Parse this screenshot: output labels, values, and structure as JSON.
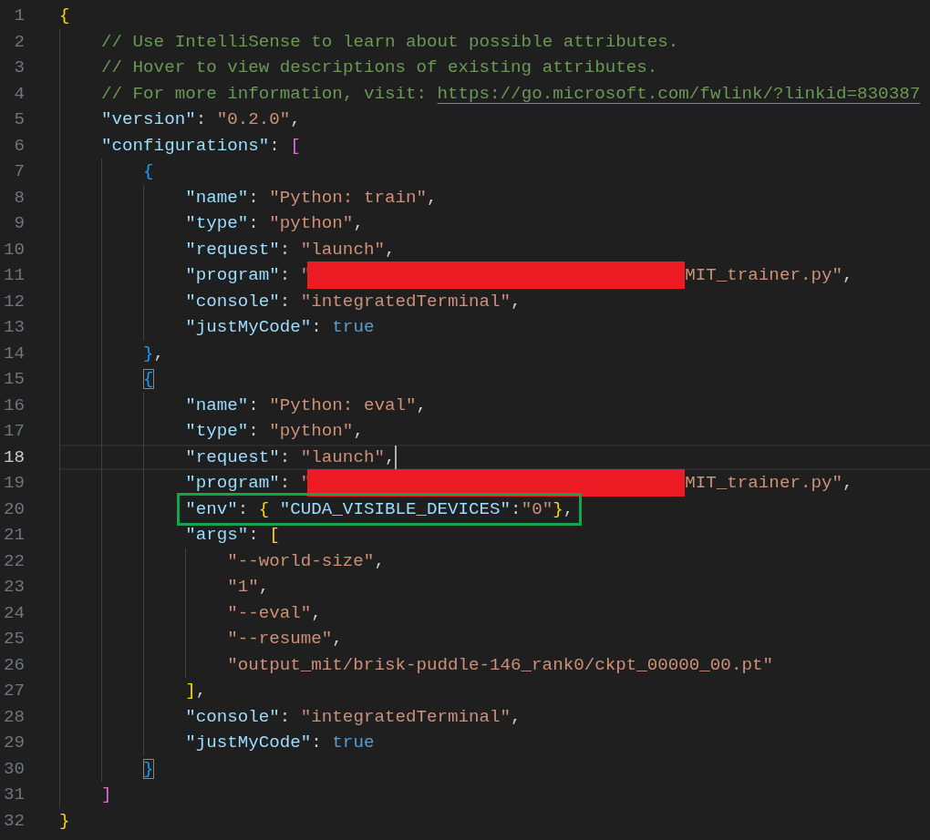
{
  "editor": {
    "lines": [
      {
        "number": "1",
        "current": false,
        "boxed": false,
        "tokens": [
          {
            "kind": "bracket",
            "text": "{",
            "color": "#ffd700",
            "matched": false
          }
        ]
      },
      {
        "number": "2",
        "current": false,
        "boxed": false,
        "tokens": [
          {
            "kind": "comment",
            "text": "    // Use IntelliSense to learn about possible attributes."
          }
        ]
      },
      {
        "number": "3",
        "current": false,
        "boxed": false,
        "tokens": [
          {
            "kind": "comment",
            "text": "    // Hover to view descriptions of existing attributes."
          }
        ]
      },
      {
        "number": "4",
        "current": false,
        "boxed": false,
        "tokens": [
          {
            "kind": "comment",
            "text": "    // For more information, visit: "
          },
          {
            "kind": "link",
            "text": "https://go.microsoft.com/fwlink/?linkid=830387"
          }
        ]
      },
      {
        "number": "5",
        "current": false,
        "boxed": false,
        "tokens": [
          {
            "kind": "key",
            "text": "    \"version\""
          },
          {
            "kind": "punct",
            "text": ": "
          },
          {
            "kind": "string",
            "text": "\"0.2.0\""
          },
          {
            "kind": "punct",
            "text": ","
          }
        ]
      },
      {
        "number": "6",
        "current": false,
        "boxed": false,
        "tokens": [
          {
            "kind": "key",
            "text": "    \"configurations\""
          },
          {
            "kind": "punct",
            "text": ": "
          },
          {
            "kind": "bracket",
            "text": "[",
            "color": "#da70d6",
            "matched": false
          }
        ]
      },
      {
        "number": "7",
        "current": false,
        "boxed": false,
        "tokens": [
          {
            "kind": "bracket",
            "text": "        {",
            "color": "#179fff",
            "matched": false
          }
        ]
      },
      {
        "number": "8",
        "current": false,
        "boxed": false,
        "tokens": [
          {
            "kind": "key",
            "text": "            \"name\""
          },
          {
            "kind": "punct",
            "text": ": "
          },
          {
            "kind": "string",
            "text": "\"Python: train\""
          },
          {
            "kind": "punct",
            "text": ","
          }
        ]
      },
      {
        "number": "9",
        "current": false,
        "boxed": false,
        "tokens": [
          {
            "kind": "key",
            "text": "            \"type\""
          },
          {
            "kind": "punct",
            "text": ": "
          },
          {
            "kind": "string",
            "text": "\"python\""
          },
          {
            "kind": "punct",
            "text": ","
          }
        ]
      },
      {
        "number": "10",
        "current": false,
        "boxed": false,
        "tokens": [
          {
            "kind": "key",
            "text": "            \"request\""
          },
          {
            "kind": "punct",
            "text": ": "
          },
          {
            "kind": "string",
            "text": "\"launch\""
          },
          {
            "kind": "punct",
            "text": ","
          }
        ]
      },
      {
        "number": "11",
        "current": false,
        "boxed": false,
        "tokens": [
          {
            "kind": "key",
            "text": "            \"program\""
          },
          {
            "kind": "punct",
            "text": ": "
          },
          {
            "kind": "string",
            "text": "\""
          },
          {
            "kind": "redaction"
          },
          {
            "kind": "string",
            "text": "MIT_trainer.py\""
          },
          {
            "kind": "punct",
            "text": ","
          }
        ]
      },
      {
        "number": "12",
        "current": false,
        "boxed": false,
        "tokens": [
          {
            "kind": "key",
            "text": "            \"console\""
          },
          {
            "kind": "punct",
            "text": ": "
          },
          {
            "kind": "string",
            "text": "\"integratedTerminal\""
          },
          {
            "kind": "punct",
            "text": ","
          }
        ]
      },
      {
        "number": "13",
        "current": false,
        "boxed": false,
        "tokens": [
          {
            "kind": "key",
            "text": "            \"justMyCode\""
          },
          {
            "kind": "punct",
            "text": ": "
          },
          {
            "kind": "keyword",
            "text": "true"
          }
        ]
      },
      {
        "number": "14",
        "current": false,
        "boxed": false,
        "tokens": [
          {
            "kind": "bracket",
            "text": "        }",
            "color": "#179fff",
            "matched": false
          },
          {
            "kind": "punct",
            "text": ","
          }
        ]
      },
      {
        "number": "15",
        "current": false,
        "boxed": false,
        "tokens": [
          {
            "kind": "bracket",
            "text": "        {",
            "color": "#179fff",
            "matched": true
          }
        ]
      },
      {
        "number": "16",
        "current": false,
        "boxed": false,
        "tokens": [
          {
            "kind": "key",
            "text": "            \"name\""
          },
          {
            "kind": "punct",
            "text": ": "
          },
          {
            "kind": "string",
            "text": "\"Python: eval\""
          },
          {
            "kind": "punct",
            "text": ","
          }
        ]
      },
      {
        "number": "17",
        "current": false,
        "boxed": false,
        "tokens": [
          {
            "kind": "key",
            "text": "            \"type\""
          },
          {
            "kind": "punct",
            "text": ": "
          },
          {
            "kind": "string",
            "text": "\"python\""
          },
          {
            "kind": "punct",
            "text": ","
          }
        ]
      },
      {
        "number": "18",
        "current": true,
        "boxed": false,
        "tokens": [
          {
            "kind": "key",
            "text": "            \"request\""
          },
          {
            "kind": "punct",
            "text": ": "
          },
          {
            "kind": "string",
            "text": "\"launch\""
          },
          {
            "kind": "punct",
            "text": ","
          }
        ]
      },
      {
        "number": "19",
        "current": false,
        "boxed": false,
        "tokens": [
          {
            "kind": "key",
            "text": "            \"program\""
          },
          {
            "kind": "punct",
            "text": ": "
          },
          {
            "kind": "string",
            "text": "\""
          },
          {
            "kind": "redaction"
          },
          {
            "kind": "string",
            "text": "MIT_trainer.py\""
          },
          {
            "kind": "punct",
            "text": ","
          }
        ]
      },
      {
        "number": "20",
        "current": false,
        "boxed": true,
        "tokens": [
          {
            "kind": "key",
            "text": "            \"env\""
          },
          {
            "kind": "punct",
            "text": ": "
          },
          {
            "kind": "bracket",
            "text": "{ ",
            "color": "#ffd700",
            "matched": false
          },
          {
            "kind": "key",
            "text": "\"CUDA_VISIBLE_DEVICES\""
          },
          {
            "kind": "punct",
            "text": ":"
          },
          {
            "kind": "string",
            "text": "\"0\""
          },
          {
            "kind": "bracket",
            "text": "}",
            "color": "#ffd700",
            "matched": false
          },
          {
            "kind": "punct",
            "text": ","
          }
        ]
      },
      {
        "number": "21",
        "current": false,
        "boxed": false,
        "tokens": [
          {
            "kind": "key",
            "text": "            \"args\""
          },
          {
            "kind": "punct",
            "text": ": "
          },
          {
            "kind": "bracket",
            "text": "[",
            "color": "#ffd700",
            "matched": false
          }
        ]
      },
      {
        "number": "22",
        "current": false,
        "boxed": false,
        "tokens": [
          {
            "kind": "string",
            "text": "                \"--world-size\""
          },
          {
            "kind": "punct",
            "text": ","
          }
        ]
      },
      {
        "number": "23",
        "current": false,
        "boxed": false,
        "tokens": [
          {
            "kind": "string",
            "text": "                \"1\""
          },
          {
            "kind": "punct",
            "text": ","
          }
        ]
      },
      {
        "number": "24",
        "current": false,
        "boxed": false,
        "tokens": [
          {
            "kind": "string",
            "text": "                \"--eval\""
          },
          {
            "kind": "punct",
            "text": ","
          }
        ]
      },
      {
        "number": "25",
        "current": false,
        "boxed": false,
        "tokens": [
          {
            "kind": "string",
            "text": "                \"--resume\""
          },
          {
            "kind": "punct",
            "text": ","
          }
        ]
      },
      {
        "number": "26",
        "current": false,
        "boxed": false,
        "tokens": [
          {
            "kind": "string",
            "text": "                \"output_mit/brisk-puddle-146_rank0/ckpt_00000_00.pt\""
          }
        ]
      },
      {
        "number": "27",
        "current": false,
        "boxed": false,
        "tokens": [
          {
            "kind": "bracket",
            "text": "            ]",
            "color": "#ffd700",
            "matched": false
          },
          {
            "kind": "punct",
            "text": ","
          }
        ]
      },
      {
        "number": "28",
        "current": false,
        "boxed": false,
        "tokens": [
          {
            "kind": "key",
            "text": "            \"console\""
          },
          {
            "kind": "punct",
            "text": ": "
          },
          {
            "kind": "string",
            "text": "\"integratedTerminal\""
          },
          {
            "kind": "punct",
            "text": ","
          }
        ]
      },
      {
        "number": "29",
        "current": false,
        "boxed": false,
        "tokens": [
          {
            "kind": "key",
            "text": "            \"justMyCode\""
          },
          {
            "kind": "punct",
            "text": ": "
          },
          {
            "kind": "keyword",
            "text": "true"
          }
        ]
      },
      {
        "number": "30",
        "current": false,
        "boxed": false,
        "tokens": [
          {
            "kind": "bracket",
            "text": "        }",
            "color": "#179fff",
            "matched": true
          }
        ]
      },
      {
        "number": "31",
        "current": false,
        "boxed": false,
        "tokens": [
          {
            "kind": "bracket",
            "text": "    ]",
            "color": "#da70d6",
            "matched": false
          }
        ]
      },
      {
        "number": "32",
        "current": false,
        "boxed": false,
        "tokens": [
          {
            "kind": "bracket",
            "text": "}",
            "color": "#ffd700",
            "matched": false
          }
        ]
      }
    ]
  }
}
